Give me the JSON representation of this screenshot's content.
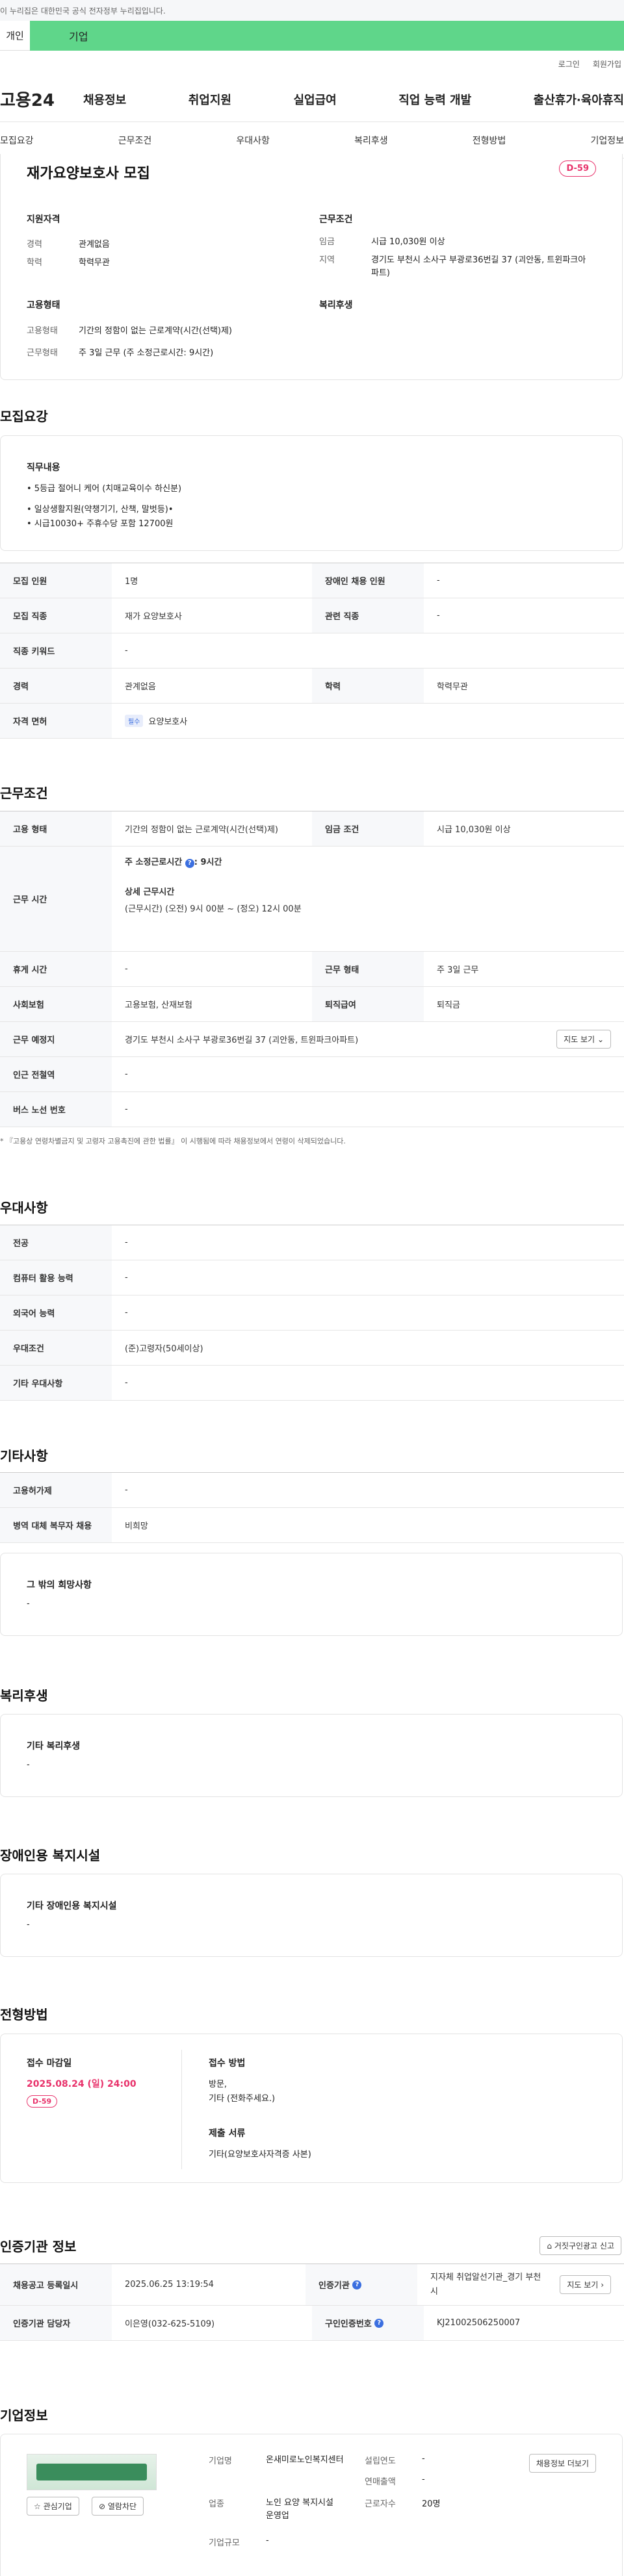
{
  "gov_bar": "이 누리집은 대한민국 공식 전자정부 누리집입니다.",
  "tabs": {
    "left": "개인",
    "right": "기업"
  },
  "util": {
    "login": "로그인",
    "join": "회원가입"
  },
  "gnb": {
    "logo": "고용24",
    "items": [
      "채용정보",
      "취업지원",
      "실업급여",
      "직업 능력 개발",
      "출산휴가·육아휴직"
    ]
  },
  "subtabs": [
    "모집요강",
    "근무조건",
    "우대사항",
    "복리후생",
    "전형방법",
    "기업정보"
  ],
  "summary": {
    "title": "재가요양보호사 모집",
    "dday": "D-59",
    "qual_title": "지원자격",
    "qual": [
      {
        "k": "경력",
        "v": "관계없음"
      },
      {
        "k": "학력",
        "v": "학력무관"
      }
    ],
    "work_title": "근무조건",
    "work": [
      {
        "k": "임금",
        "v": "시급 10,030원 이상"
      },
      {
        "k": "지역",
        "v": "경기도 부천시 소사구 부광로36번길 37 (괴안동, 트윈파크아파트)"
      }
    ],
    "emp_title": "고용형태",
    "emp": [
      {
        "k": "고용형태",
        "v": "기간의 정함이 없는 근로계약(시간(선택)제)"
      },
      {
        "k": "근무형태",
        "v": "주 3일 근무 (주 소정근로시간: 9시간)"
      }
    ],
    "welfare_title": "복리후생"
  },
  "recruit": {
    "title": "모집요강",
    "job_title": "직무내용",
    "job_lines": [
      "• 5등급 절어니 케어 (치매교육이수 하신분)",
      "• 일상생활지원(약챙기기, 산책, 말벗등)•",
      "• 시급10030+ 주휴수당 포함 12700원"
    ],
    "rows": [
      [
        {
          "k": "모집 인원",
          "v": "1명"
        },
        {
          "k": "장애인 채용 인원",
          "v": "-"
        }
      ],
      [
        {
          "k": "모집 직종",
          "v": "재가 요양보호사"
        },
        {
          "k": "관련 직종",
          "v": "-"
        }
      ],
      [
        {
          "k": "직종 키워드",
          "v": "-"
        }
      ],
      [
        {
          "k": "경력",
          "v": "관계없음"
        },
        {
          "k": "학력",
          "v": "학력무관"
        }
      ]
    ],
    "license_k": "자격 면허",
    "license_tag": "필수",
    "license_v": "요양보호사"
  },
  "work": {
    "title": "근무조건",
    "r1": [
      {
        "k": "고용 형태",
        "v": "기간의 정함이 없는 근로계약(시간(선택)제)"
      },
      {
        "k": "임금 조건",
        "v": "시급 10,030원 이상"
      }
    ],
    "hours_k": "근무 시간",
    "hours_week": "주 소정근로시간",
    "hours_week_v": ": 9시간",
    "hours_detail_t": "상세 근무시간",
    "hours_detail_v": "(근무시간) (오전) 9시 00분 ~ (정오) 12시 00분",
    "r2": [
      {
        "k": "휴게 시간",
        "v": "-"
      },
      {
        "k": "근무 형태",
        "v": "주 3일 근무"
      }
    ],
    "r3": [
      {
        "k": "사회보험",
        "v": "고용보험, 산재보험"
      },
      {
        "k": "퇴직급여",
        "v": "퇴직금"
      }
    ],
    "place_k": "근무 예정지",
    "place_v": "경기도 부천시 소사구 부광로36번길 37 (괴안동, 트윈파크아파트)",
    "map_btn": "지도 보기",
    "station_k": "인근 전철역",
    "station_v": "-",
    "bus_k": "버스 노선 번호",
    "bus_v": "-",
    "note": "* 『고용상 연령차별금지 및 고령자 고용촉진에 관한 법률』 이 시행됨에 따라 채용정보에서 연령이 삭제되었습니다."
  },
  "pref": {
    "title": "우대사항",
    "rows": [
      {
        "k": "전공",
        "v": "-"
      },
      {
        "k": "컴퓨터 활용 능력",
        "v": "-"
      },
      {
        "k": "외국어 능력",
        "v": "-"
      },
      {
        "k": "우대조건",
        "v": "(준)고령자(50세이상)"
      },
      {
        "k": "기타 우대사항",
        "v": "-"
      }
    ]
  },
  "etc": {
    "title": "기타사항",
    "rows": [
      {
        "k": "고용허가제",
        "v": "-"
      },
      {
        "k": "병역 대체 복무자 채용",
        "v": "비희망"
      }
    ],
    "hope_t": "그 밖의 희망사항",
    "hope_v": "-"
  },
  "welfare": {
    "title": "복리후생",
    "card_t": "기타 복리후생",
    "card_v": "-"
  },
  "disabled": {
    "title": "장애인용 복지시설",
    "card_t": "기타 장애인용 복지시설",
    "card_v": "-"
  },
  "process": {
    "title": "전형방법",
    "deadline_t": "접수 마감일",
    "deadline_v": "2025.08.24 (일) 24:00",
    "dday": "D-59",
    "method_t": "접수 방법",
    "method_v1": "방문,",
    "method_v2": "기타 (전화주세요.)",
    "docs_t": "제출 서류",
    "docs_v": "기타(요양보호사자격증 사본)"
  },
  "cert": {
    "title": "인증기관 정보",
    "report_btn": "거짓구인광고 신고",
    "r1": [
      {
        "k": "채용공고 등록일시",
        "v": "2025.06.25 13:19:54"
      },
      {
        "k": "인증기관",
        "v": "지자체 취업알선기관_경기 부천시"
      }
    ],
    "map_btn": "지도 보기",
    "r2": [
      {
        "k": "인증기관 담당자",
        "v": "이은영(032-625-5109)"
      },
      {
        "k": "구인인증번호",
        "v": "KJ21002506250007"
      }
    ]
  },
  "company": {
    "title": "기업정보",
    "fav_btn": "관심기업",
    "block_btn": "열람차단",
    "name_k": "기업명",
    "name_v": "온새미로노인복지센터",
    "ind_k": "업종",
    "ind_v": "노인 요양 복지시설 운영업",
    "scale_k": "기업규모",
    "scale_v": "-",
    "est_k": "설립연도",
    "est_v": "-",
    "sales_k": "연매출액",
    "sales_v": "-",
    "emp_k": "근로자수",
    "emp_v": "20명",
    "more_btn": "채용정보 더보기"
  },
  "colors": {
    "green": "#5fd68a",
    "pink": "#e8316a",
    "blue": "#3b6fe0"
  }
}
